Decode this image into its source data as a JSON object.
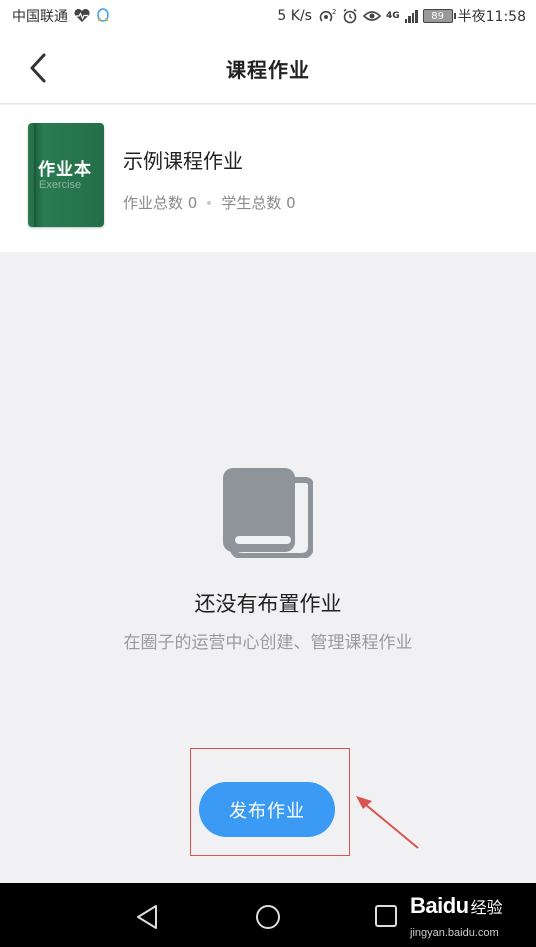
{
  "status_bar": {
    "carrier": "中国联通",
    "speed": "5 K/s",
    "network": "4G",
    "battery": "89",
    "time": "半夜11:58"
  },
  "header": {
    "title": "课程作业"
  },
  "course": {
    "cover_title": "作业本",
    "cover_subtitle": "Exercise",
    "name": "示例课程作业",
    "assignments_stat": "作业总数 0",
    "students_stat": "学生总数 0"
  },
  "empty_state": {
    "title": "还没有布置作业",
    "description": "在圈子的运营中心创建、管理课程作业",
    "icon": "book-icon"
  },
  "actions": {
    "publish_label": "发布作业"
  },
  "watermark": {
    "brand": "Baidu",
    "suffix": "经验",
    "url": "jingyan.baidu.com"
  },
  "colors": {
    "accent": "#3a9af4",
    "cover": "#236e48",
    "annotation": "#d9534f"
  }
}
